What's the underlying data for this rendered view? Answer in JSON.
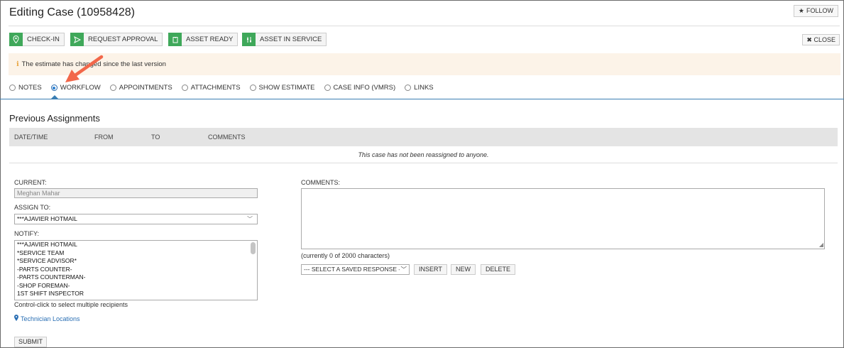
{
  "header": {
    "title": "Editing Case (10958428)",
    "follow_label": "FOLLOW"
  },
  "actions": {
    "check_in": "CHECK-IN",
    "request_approval": "REQUEST APPROVAL",
    "asset_ready": "ASSET READY",
    "asset_in_service": "ASSET IN SERVICE",
    "close": "CLOSE"
  },
  "alert": {
    "text": "The estimate has changed since the last version"
  },
  "tabs": [
    {
      "label": "NOTES",
      "selected": false
    },
    {
      "label": "WORKFLOW",
      "selected": true
    },
    {
      "label": "APPOINTMENTS",
      "selected": false
    },
    {
      "label": "ATTACHMENTS",
      "selected": false
    },
    {
      "label": "SHOW ESTIMATE",
      "selected": false
    },
    {
      "label": "CASE INFO (VMRS)",
      "selected": false
    },
    {
      "label": "LINKS",
      "selected": false
    }
  ],
  "previous_assignments": {
    "title": "Previous Assignments",
    "columns": [
      "DATE/TIME",
      "FROM",
      "TO",
      "COMMENTS"
    ],
    "empty_message": "This case has not been reassigned to anyone."
  },
  "form": {
    "current_label": "CURRENT:",
    "current_value": "Meghan Mahar",
    "assign_label": "ASSIGN TO:",
    "assign_value": "***AJAVIER HOTMAIL",
    "notify_label": "NOTIFY:",
    "notify_options": [
      "***AJAVIER HOTMAIL",
      "*SERVICE TEAM",
      "*SERVICE ADVISOR*",
      "-PARTS COUNTER-",
      "-PARTS COUNTERMAN-",
      "-SHOP FOREMAN-",
      "1ST SHIFT INSPECTOR"
    ],
    "notify_hint": "Control-click to select multiple recipients",
    "tech_link": "Technician Locations",
    "submit": "SUBMIT",
    "comments_label": "COMMENTS:",
    "comments_value": "",
    "char_count": "(currently 0 of 2000 characters)",
    "saved_response": "--- SELECT A SAVED RESPONSE ---",
    "insert": "INSERT",
    "new": "NEW",
    "delete": "DELETE"
  },
  "colors": {
    "action_icon_green": "#3fa85a",
    "alert_bg": "#fcf3e8",
    "tab_accent": "#3a7eb3",
    "annotation_arrow": "#f2674a",
    "link_blue": "#2a6fb4"
  }
}
